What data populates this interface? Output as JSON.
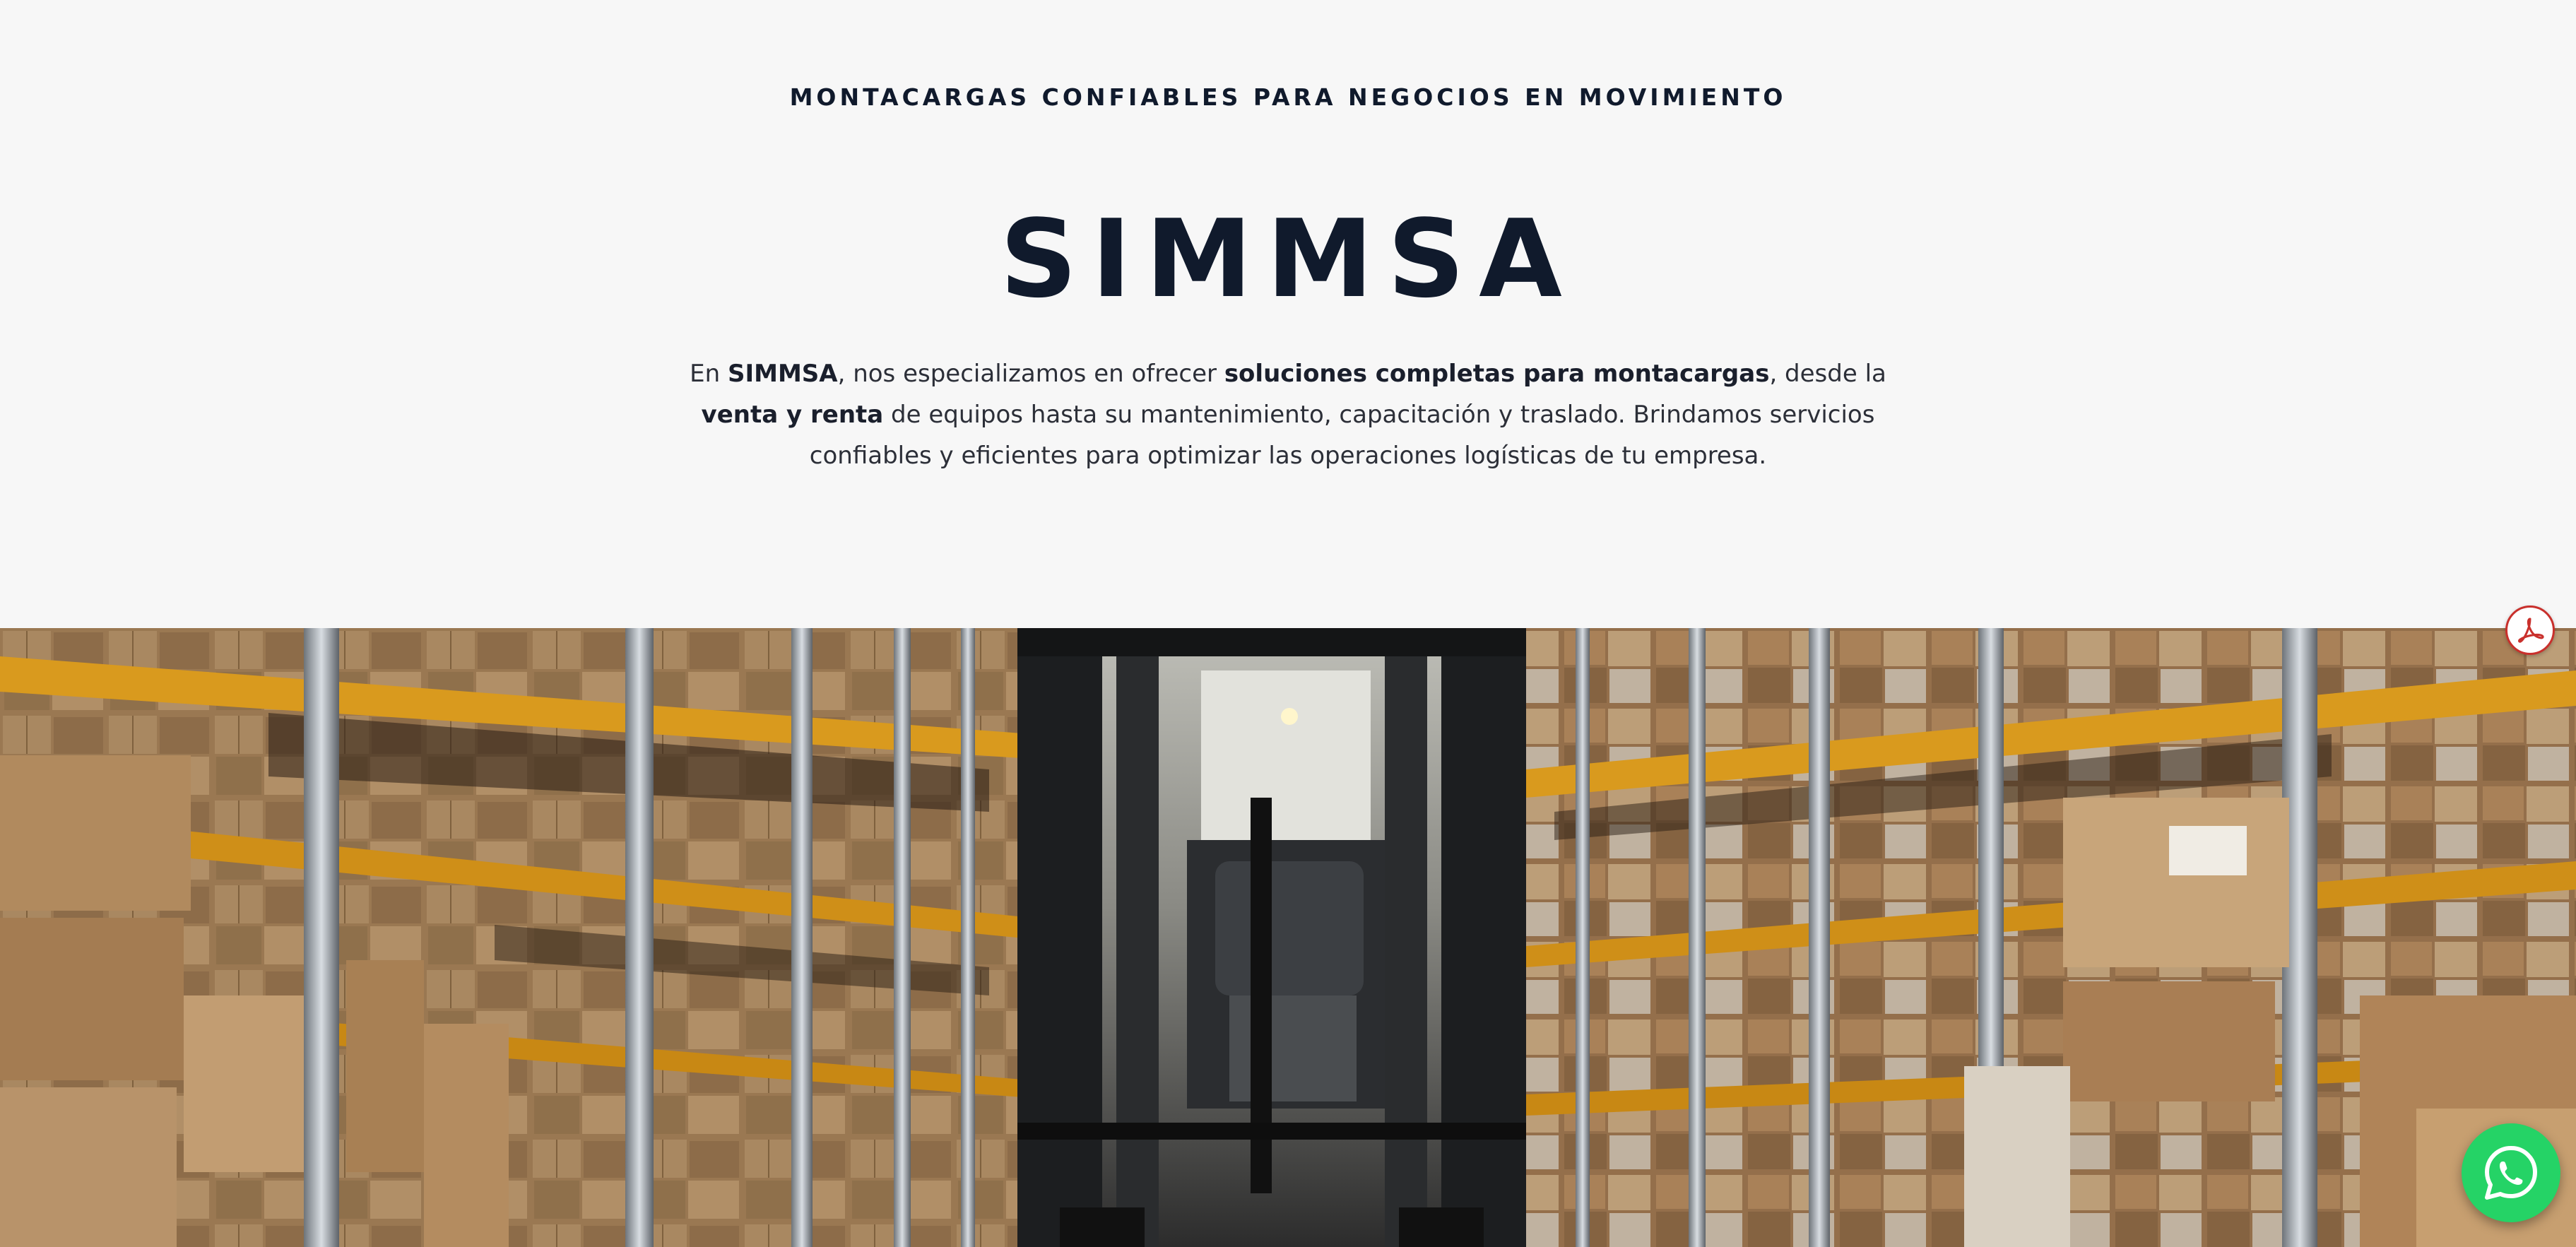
{
  "hero": {
    "eyebrow": "MONTACARGAS CONFIABLES PARA NEGOCIOS EN MOVIMIENTO",
    "brand": "SIMMSA",
    "intro": {
      "p1": "En ",
      "b1": "SIMMSA",
      "p2": ", nos especializamos en ofrecer ",
      "b2": "soluciones completas para montacargas",
      "p3": ", desde la ",
      "b3": "venta y renta",
      "p4": " de equipos hasta su mantenimiento, capacitación y traslado. Brindamos servicios confiables y eficientes para optimizar las operaciones logísticas de tu empresa."
    }
  },
  "floating": {
    "pdf_icon": "acrobat-pdf-icon",
    "whatsapp_icon": "whatsapp-icon"
  },
  "colors": {
    "background": "#f7f7f7",
    "heading": "#101a2c",
    "body_text": "#2c2f38",
    "whatsapp_green": "#25d366",
    "pdf_red": "#c9302c"
  }
}
